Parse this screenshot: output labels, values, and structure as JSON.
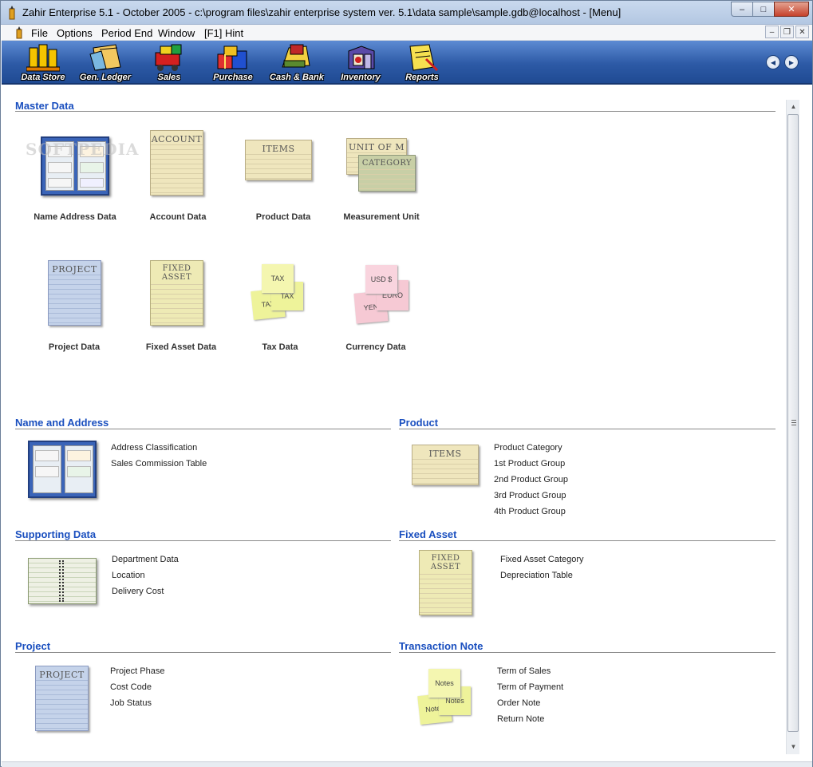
{
  "window": {
    "title": "Zahir Enterprise 5.1 - October 2005 - c:\\program files\\zahir enterprise system ver. 5.1\\data sample\\sample.gdb@localhost - [Menu]",
    "minimize": "–",
    "maximize": "□",
    "close": "✕"
  },
  "menu": {
    "items": [
      "File",
      "Options",
      "Period End",
      "Window",
      "[F1] Hint"
    ],
    "mdi_minimize": "–",
    "mdi_restore": "❐",
    "mdi_close": "✕"
  },
  "toolbar": {
    "items": [
      {
        "label": "Data Store",
        "icon": "data-store-icon"
      },
      {
        "label": "Gen. Ledger",
        "icon": "ledger-icon"
      },
      {
        "label": "Sales",
        "icon": "sales-icon"
      },
      {
        "label": "Purchase",
        "icon": "purchase-icon"
      },
      {
        "label": "Cash & Bank",
        "icon": "cash-bank-icon"
      },
      {
        "label": "Inventory",
        "icon": "inventory-icon"
      },
      {
        "label": "Reports",
        "icon": "reports-icon"
      }
    ],
    "prev_arrow": "◀",
    "next_arrow": "▶"
  },
  "master_data": {
    "title": "Master Data",
    "tiles": [
      {
        "label": "Name  Address Data",
        "art": "Name  Address"
      },
      {
        "label": "Account Data",
        "art": "ACCOUNT"
      },
      {
        "label": "Product Data",
        "art": "ITEMS"
      },
      {
        "label": "Measurement Unit",
        "art": "UNIT OF M",
        "art2": "CATEGORY"
      },
      {
        "label": "Project Data",
        "art": "PROJECT"
      },
      {
        "label": "Fixed Asset Data",
        "art": "FIXED ASSET"
      },
      {
        "label": "Tax Data",
        "art": "TAX"
      },
      {
        "label": "Currency Data",
        "art": "USD $",
        "art2": "EURO",
        "art3": "YEN"
      }
    ],
    "watermark": "SOFTPEDIA"
  },
  "name_address": {
    "title": "Name and Address",
    "links": [
      "Address Classification",
      "Sales Commission Table"
    ]
  },
  "product": {
    "title": "Product",
    "art": "ITEMS",
    "links": [
      "Product Category",
      "1st Product Group",
      "2nd Product Group",
      "3rd Product Group",
      "4th Product Group"
    ]
  },
  "supporting": {
    "title": "Supporting Data",
    "links": [
      "Department Data",
      "Location",
      "Delivery Cost"
    ]
  },
  "fixed_asset": {
    "title": "Fixed Asset",
    "art": "FIXED ASSET",
    "links": [
      "Fixed Asset Category",
      "Depreciation Table"
    ]
  },
  "project": {
    "title": "Project",
    "art": "PROJECT",
    "links": [
      "Project Phase",
      "Cost Code",
      "Job Status"
    ]
  },
  "transaction_note": {
    "title": "Transaction Note",
    "art": "Notes",
    "links": [
      "Term of Sales",
      "Term of Payment",
      "Order Note",
      "Return Note"
    ]
  },
  "scrollbar": {
    "up": "▲",
    "down": "▼"
  },
  "colors": {
    "section_title": "#1a4fbf",
    "toolbar_blue": "#2d5aa6",
    "paper_yellow": "#efe6bd",
    "paper_blue": "#c5d3ea",
    "note_yellow": "#f4f2a8",
    "note_pink": "#f6c9d4"
  }
}
